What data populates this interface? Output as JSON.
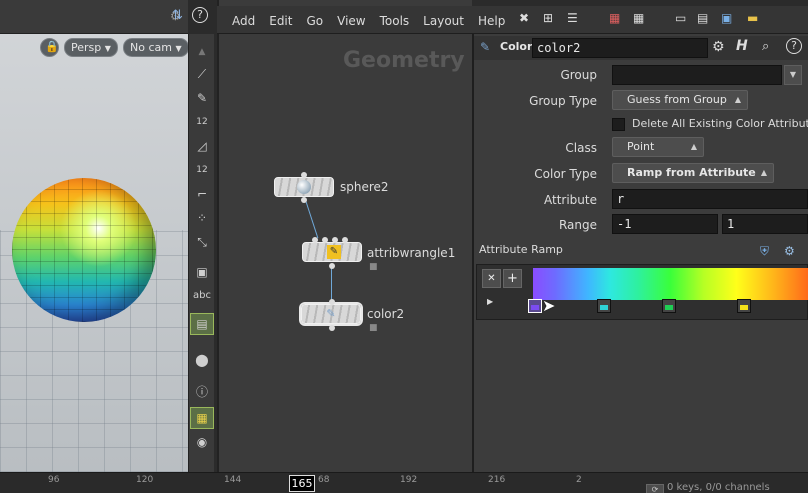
{
  "viewport": {
    "perspective": "Persp",
    "camera": "No cam",
    "toolbar_label_12a": "12",
    "toolbar_label_12b": "12",
    "toolbar_label_abc": "abc"
  },
  "menu": {
    "items": [
      "Add",
      "Edit",
      "Go",
      "View",
      "Tools",
      "Layout",
      "Help"
    ]
  },
  "network": {
    "context_label": "Geometry",
    "nodes": [
      {
        "name": "sphere2"
      },
      {
        "name": "attribwrangle1"
      },
      {
        "name": "color2"
      }
    ]
  },
  "params": {
    "node_type": "Color",
    "node_name": "color2",
    "group_label": "Group",
    "group_value": "",
    "group_type_label": "Group Type",
    "group_type_value": "Guess from Group",
    "delete_attrs_label": "Delete All Existing Color Attributes",
    "class_label": "Class",
    "class_value": "Point",
    "color_type_label": "Color Type",
    "color_type_value": "Ramp from Attribute",
    "attribute_label": "Attribute",
    "attribute_value": "r",
    "range_label": "Range",
    "range_min": "-1",
    "range_max": "1",
    "ramp_label": "Attribute Ramp",
    "ramp_keys": [
      {
        "position": 0.0,
        "color": "#7b4cf0"
      },
      {
        "position": 0.27,
        "color": "#2fd3d8"
      },
      {
        "position": 0.52,
        "color": "#1fcf54"
      },
      {
        "position": 0.79,
        "color": "#f4e21a"
      }
    ]
  },
  "timeline": {
    "ticks": [
      "96",
      "120",
      "144",
      "68",
      "192",
      "216",
      "2"
    ],
    "current_frame": "165",
    "keys_text": "0 keys, 0/0 channels"
  },
  "colors": {
    "accent_green": "#9ab85b",
    "wire_blue": "#6fa8d8"
  }
}
